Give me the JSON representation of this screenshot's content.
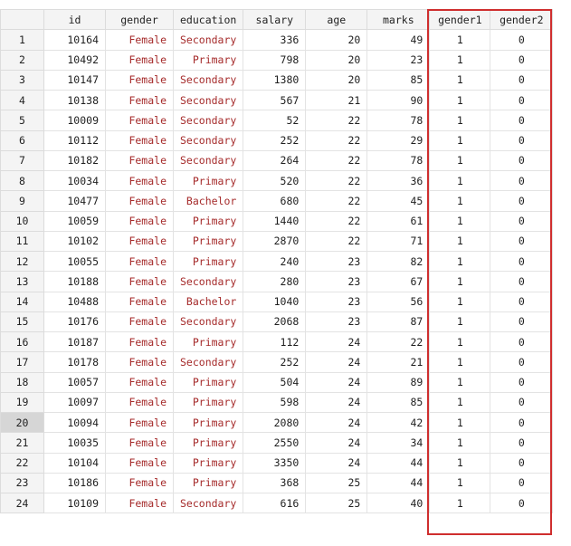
{
  "columns": [
    "",
    "id",
    "gender",
    "education",
    "salary",
    "age",
    "marks",
    "gender1",
    "gender2"
  ],
  "selected_row": "20",
  "colors": {
    "string_value": "#a52a2a",
    "highlight_border": "#cf2e2e"
  },
  "rows": [
    [
      "1",
      "10164",
      "Female",
      "Secondary",
      "336",
      "20",
      "49",
      "1",
      "0"
    ],
    [
      "2",
      "10492",
      "Female",
      "Primary",
      "798",
      "20",
      "23",
      "1",
      "0"
    ],
    [
      "3",
      "10147",
      "Female",
      "Secondary",
      "1380",
      "20",
      "85",
      "1",
      "0"
    ],
    [
      "4",
      "10138",
      "Female",
      "Secondary",
      "567",
      "21",
      "90",
      "1",
      "0"
    ],
    [
      "5",
      "10009",
      "Female",
      "Secondary",
      "52",
      "22",
      "78",
      "1",
      "0"
    ],
    [
      "6",
      "10112",
      "Female",
      "Secondary",
      "252",
      "22",
      "29",
      "1",
      "0"
    ],
    [
      "7",
      "10182",
      "Female",
      "Secondary",
      "264",
      "22",
      "78",
      "1",
      "0"
    ],
    [
      "8",
      "10034",
      "Female",
      "Primary",
      "520",
      "22",
      "36",
      "1",
      "0"
    ],
    [
      "9",
      "10477",
      "Female",
      "Bachelor",
      "680",
      "22",
      "45",
      "1",
      "0"
    ],
    [
      "10",
      "10059",
      "Female",
      "Primary",
      "1440",
      "22",
      "61",
      "1",
      "0"
    ],
    [
      "11",
      "10102",
      "Female",
      "Primary",
      "2870",
      "22",
      "71",
      "1",
      "0"
    ],
    [
      "12",
      "10055",
      "Female",
      "Primary",
      "240",
      "23",
      "82",
      "1",
      "0"
    ],
    [
      "13",
      "10188",
      "Female",
      "Secondary",
      "280",
      "23",
      "67",
      "1",
      "0"
    ],
    [
      "14",
      "10488",
      "Female",
      "Bachelor",
      "1040",
      "23",
      "56",
      "1",
      "0"
    ],
    [
      "15",
      "10176",
      "Female",
      "Secondary",
      "2068",
      "23",
      "87",
      "1",
      "0"
    ],
    [
      "16",
      "10187",
      "Female",
      "Primary",
      "112",
      "24",
      "22",
      "1",
      "0"
    ],
    [
      "17",
      "10178",
      "Female",
      "Secondary",
      "252",
      "24",
      "21",
      "1",
      "0"
    ],
    [
      "18",
      "10057",
      "Female",
      "Primary",
      "504",
      "24",
      "89",
      "1",
      "0"
    ],
    [
      "19",
      "10097",
      "Female",
      "Primary",
      "598",
      "24",
      "85",
      "1",
      "0"
    ],
    [
      "20",
      "10094",
      "Female",
      "Primary",
      "2080",
      "24",
      "42",
      "1",
      "0"
    ],
    [
      "21",
      "10035",
      "Female",
      "Primary",
      "2550",
      "24",
      "34",
      "1",
      "0"
    ],
    [
      "22",
      "10104",
      "Female",
      "Primary",
      "3350",
      "24",
      "44",
      "1",
      "0"
    ],
    [
      "23",
      "10186",
      "Female",
      "Primary",
      "368",
      "25",
      "44",
      "1",
      "0"
    ],
    [
      "24",
      "10109",
      "Female",
      "Secondary",
      "616",
      "25",
      "40",
      "1",
      "0"
    ]
  ]
}
